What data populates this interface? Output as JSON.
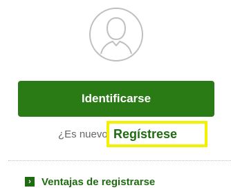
{
  "avatar": {
    "icon": "user-silhouette-icon"
  },
  "login": {
    "label": "Identificarse"
  },
  "signup": {
    "prompt": "¿Es nuevo?",
    "link_label": "Regístrese"
  },
  "benefits": {
    "icon": "chevron-right-icon",
    "icon_glyph": "›",
    "label": "Ventajas de registrarse"
  },
  "colors": {
    "brand_green": "#2a7a16",
    "link_green": "#1f6b12",
    "highlight": "#f2f200",
    "muted_text": "#666666"
  }
}
